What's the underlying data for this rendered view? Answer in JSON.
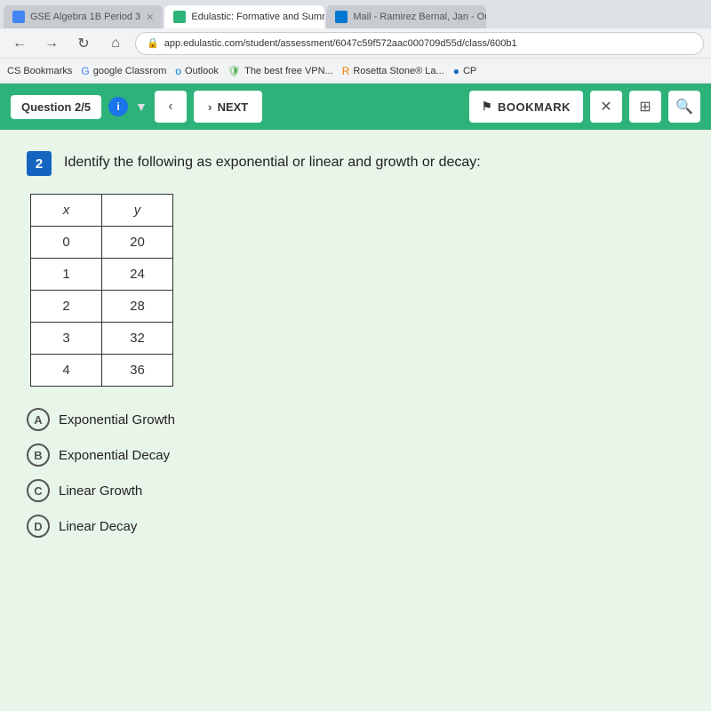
{
  "browser": {
    "tabs": [
      {
        "id": "tab1",
        "label": "GSE Algebra 1B Period 3",
        "active": false,
        "favicon_color": "#4285f4"
      },
      {
        "id": "tab2",
        "label": "Edulastic: Formative and Summ...",
        "active": true,
        "favicon_color": "#2db37a"
      },
      {
        "id": "tab3",
        "label": "Mail - Ramirez Bernal, Jan - Out...",
        "active": false,
        "favicon_color": "#0078d4"
      }
    ],
    "address": "app.edulastic.com/student/assessment/6047c59f572aac000709d55d/class/600b1",
    "bookmarks": [
      {
        "label": "CS Bookmarks"
      },
      {
        "label": "google Classrom"
      },
      {
        "label": "Outlook"
      },
      {
        "label": "The best free VPN..."
      },
      {
        "label": "Rosetta Stone® La..."
      },
      {
        "label": "CP"
      }
    ]
  },
  "toolbar": {
    "question_indicator": "Question 2/5",
    "prev_label": "‹",
    "next_label": "NEXT",
    "bookmark_label": "BOOKMARK",
    "close_label": "✕",
    "info_label": "i"
  },
  "question": {
    "number": "2",
    "text": "Identify the following as exponential or linear and growth or decay:",
    "table": {
      "headers": [
        "x",
        "y"
      ],
      "rows": [
        [
          "0",
          "20"
        ],
        [
          "1",
          "24"
        ],
        [
          "2",
          "28"
        ],
        [
          "3",
          "32"
        ],
        [
          "4",
          "36"
        ]
      ]
    },
    "options": [
      {
        "key": "A",
        "label": "Exponential Growth"
      },
      {
        "key": "B",
        "label": "Exponential Decay"
      },
      {
        "key": "C",
        "label": "Linear Growth"
      },
      {
        "key": "D",
        "label": "Linear Decay"
      }
    ]
  }
}
